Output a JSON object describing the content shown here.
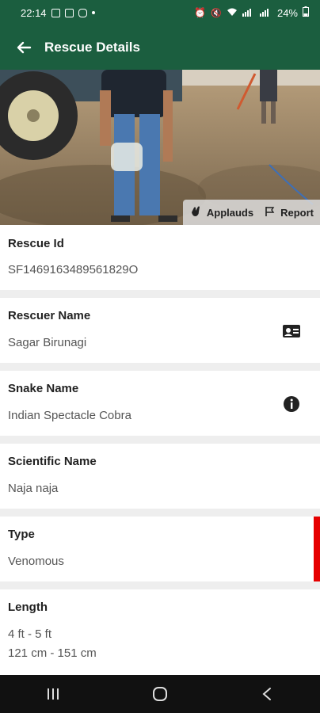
{
  "status": {
    "time": "22:14",
    "battery": "24%"
  },
  "appbar": {
    "title": "Rescue Details"
  },
  "hero": {
    "applauds_label": "Applauds",
    "report_label": "Report"
  },
  "fields": {
    "rescue_id": {
      "label": "Rescue Id",
      "value": "SF1469163489561829O"
    },
    "rescuer": {
      "label": "Rescuer Name",
      "value": "Sagar Birunagi"
    },
    "snake": {
      "label": "Snake Name",
      "value": "Indian Spectacle Cobra"
    },
    "scientific": {
      "label": "Scientific Name",
      "value": "Naja naja"
    },
    "type": {
      "label": "Type",
      "value": "Venomous",
      "indicator_color": "#e60000"
    },
    "length": {
      "label": "Length",
      "value_ft": "4 ft - 5 ft",
      "value_cm": "121 cm - 151 cm"
    }
  },
  "icons": {
    "back": "back-arrow-icon",
    "applauds": "clap-icon",
    "report": "flag-icon",
    "rescuer": "id-card-icon",
    "snake": "info-icon"
  },
  "colors": {
    "primary": "#1b5e3f",
    "type_indicator": "#e60000"
  }
}
